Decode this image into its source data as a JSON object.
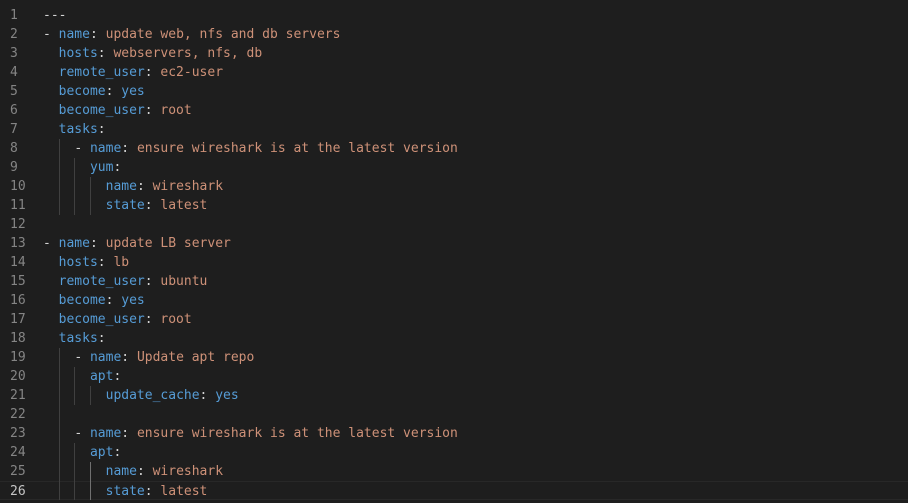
{
  "editor": {
    "language": "yaml",
    "current_line": "26",
    "lines": [
      {
        "num": "1",
        "indent": "",
        "parts": [
          {
            "t": "---",
            "c": "p"
          }
        ]
      },
      {
        "num": "2",
        "indent": "",
        "parts": [
          {
            "t": "- ",
            "c": "dash"
          },
          {
            "t": "name",
            "c": "k"
          },
          {
            "t": ": ",
            "c": "p"
          },
          {
            "t": "update web, nfs and db servers",
            "c": "v"
          }
        ]
      },
      {
        "num": "3",
        "indent": "  ",
        "parts": [
          {
            "t": "hosts",
            "c": "k"
          },
          {
            "t": ": ",
            "c": "p"
          },
          {
            "t": "webservers, nfs, db",
            "c": "v"
          }
        ]
      },
      {
        "num": "4",
        "indent": "  ",
        "parts": [
          {
            "t": "remote_user",
            "c": "k"
          },
          {
            "t": ": ",
            "c": "p"
          },
          {
            "t": "ec2-user",
            "c": "v"
          }
        ]
      },
      {
        "num": "5",
        "indent": "  ",
        "parts": [
          {
            "t": "become",
            "c": "k"
          },
          {
            "t": ": ",
            "c": "p"
          },
          {
            "t": "yes",
            "c": "k"
          }
        ]
      },
      {
        "num": "6",
        "indent": "  ",
        "parts": [
          {
            "t": "become_user",
            "c": "k"
          },
          {
            "t": ": ",
            "c": "p"
          },
          {
            "t": "root",
            "c": "v"
          }
        ]
      },
      {
        "num": "7",
        "indent": "  ",
        "parts": [
          {
            "t": "tasks",
            "c": "k"
          },
          {
            "t": ":",
            "c": "p"
          }
        ]
      },
      {
        "num": "8",
        "indent": "    ",
        "parts": [
          {
            "t": "- ",
            "c": "dash"
          },
          {
            "t": "name",
            "c": "k"
          },
          {
            "t": ": ",
            "c": "p"
          },
          {
            "t": "ensure wireshark is at the latest version",
            "c": "v"
          }
        ]
      },
      {
        "num": "9",
        "indent": "      ",
        "parts": [
          {
            "t": "yum",
            "c": "k"
          },
          {
            "t": ":",
            "c": "p"
          }
        ]
      },
      {
        "num": "10",
        "indent": "        ",
        "parts": [
          {
            "t": "name",
            "c": "k"
          },
          {
            "t": ": ",
            "c": "p"
          },
          {
            "t": "wireshark",
            "c": "v"
          }
        ]
      },
      {
        "num": "11",
        "indent": "        ",
        "parts": [
          {
            "t": "state",
            "c": "k"
          },
          {
            "t": ": ",
            "c": "p"
          },
          {
            "t": "latest",
            "c": "v"
          }
        ]
      },
      {
        "num": "12",
        "indent": "",
        "parts": []
      },
      {
        "num": "13",
        "indent": "",
        "parts": [
          {
            "t": "- ",
            "c": "dash"
          },
          {
            "t": "name",
            "c": "k"
          },
          {
            "t": ": ",
            "c": "p"
          },
          {
            "t": "update LB server",
            "c": "v"
          }
        ]
      },
      {
        "num": "14",
        "indent": "  ",
        "parts": [
          {
            "t": "hosts",
            "c": "k"
          },
          {
            "t": ": ",
            "c": "p"
          },
          {
            "t": "lb",
            "c": "v"
          }
        ]
      },
      {
        "num": "15",
        "indent": "  ",
        "parts": [
          {
            "t": "remote_user",
            "c": "k"
          },
          {
            "t": ": ",
            "c": "p"
          },
          {
            "t": "ubuntu",
            "c": "v"
          }
        ]
      },
      {
        "num": "16",
        "indent": "  ",
        "parts": [
          {
            "t": "become",
            "c": "k"
          },
          {
            "t": ": ",
            "c": "p"
          },
          {
            "t": "yes",
            "c": "k"
          }
        ]
      },
      {
        "num": "17",
        "indent": "  ",
        "parts": [
          {
            "t": "become_user",
            "c": "k"
          },
          {
            "t": ": ",
            "c": "p"
          },
          {
            "t": "root",
            "c": "v"
          }
        ]
      },
      {
        "num": "18",
        "indent": "  ",
        "parts": [
          {
            "t": "tasks",
            "c": "k"
          },
          {
            "t": ":",
            "c": "p"
          }
        ]
      },
      {
        "num": "19",
        "indent": "    ",
        "parts": [
          {
            "t": "- ",
            "c": "dash"
          },
          {
            "t": "name",
            "c": "k"
          },
          {
            "t": ": ",
            "c": "p"
          },
          {
            "t": "Update apt repo",
            "c": "v"
          }
        ]
      },
      {
        "num": "20",
        "indent": "      ",
        "parts": [
          {
            "t": "apt",
            "c": "k"
          },
          {
            "t": ":",
            "c": "p"
          }
        ]
      },
      {
        "num": "21",
        "indent": "        ",
        "parts": [
          {
            "t": "update_cache",
            "c": "k"
          },
          {
            "t": ": ",
            "c": "p"
          },
          {
            "t": "yes",
            "c": "k"
          }
        ]
      },
      {
        "num": "22",
        "indent": "",
        "parts": []
      },
      {
        "num": "23",
        "indent": "    ",
        "parts": [
          {
            "t": "- ",
            "c": "dash"
          },
          {
            "t": "name",
            "c": "k"
          },
          {
            "t": ": ",
            "c": "p"
          },
          {
            "t": "ensure wireshark is at the latest version",
            "c": "v"
          }
        ]
      },
      {
        "num": "24",
        "indent": "      ",
        "parts": [
          {
            "t": "apt",
            "c": "k"
          },
          {
            "t": ":",
            "c": "p"
          }
        ]
      },
      {
        "num": "25",
        "indent": "        ",
        "parts": [
          {
            "t": "name",
            "c": "k"
          },
          {
            "t": ": ",
            "c": "p"
          },
          {
            "t": "wireshark",
            "c": "v"
          }
        ]
      },
      {
        "num": "26",
        "indent": "        ",
        "parts": [
          {
            "t": "state",
            "c": "k"
          },
          {
            "t": ": ",
            "c": "p"
          },
          {
            "t": "latest",
            "c": "v"
          }
        ]
      }
    ]
  },
  "colors": {
    "background": "#1e1e1e",
    "key": "#569cd6",
    "string": "#ce9178",
    "punctuation": "#d4d4d4",
    "line_number": "#858585",
    "line_number_active": "#c6c6c6"
  }
}
